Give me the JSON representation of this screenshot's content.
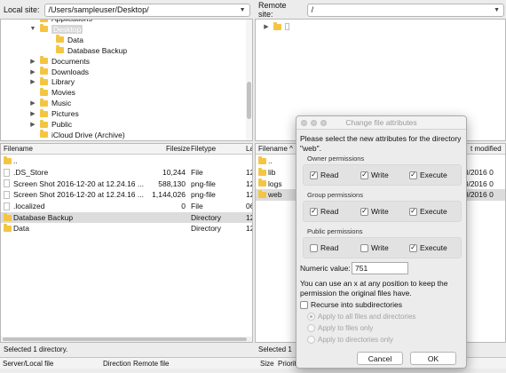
{
  "local": {
    "label": "Local site:",
    "path": "/Users/sampleuser/Desktop/",
    "tree": [
      {
        "label": "Applications",
        "indent": 1,
        "arrow": ""
      },
      {
        "label": "Desktop",
        "indent": 1,
        "arrow": "▼",
        "selected": true
      },
      {
        "label": "Data",
        "indent": 2,
        "arrow": ""
      },
      {
        "label": "Database Backup",
        "indent": 2,
        "arrow": ""
      },
      {
        "label": "Documents",
        "indent": 1,
        "arrow": "▶"
      },
      {
        "label": "Downloads",
        "indent": 1,
        "arrow": "▶"
      },
      {
        "label": "Library",
        "indent": 1,
        "arrow": "▶"
      },
      {
        "label": "Movies",
        "indent": 1,
        "arrow": ""
      },
      {
        "label": "Music",
        "indent": 1,
        "arrow": "▶"
      },
      {
        "label": "Pictures",
        "indent": 1,
        "arrow": "▶"
      },
      {
        "label": "Public",
        "indent": 1,
        "arrow": "▶"
      },
      {
        "label": "iCloud Drive (Archive)",
        "indent": 1,
        "arrow": ""
      }
    ],
    "columns": {
      "name": "Filename",
      "size": "Filesize",
      "type": "Filetype",
      "modified": "La"
    },
    "files": [
      {
        "name": "..",
        "size": "",
        "type": "",
        "mod": "",
        "icon": "folder"
      },
      {
        "name": ".DS_Store",
        "size": "10,244",
        "type": "File",
        "mod": "12",
        "icon": "file"
      },
      {
        "name": "Screen Shot 2016-12-20 at 12.24.16 ...",
        "size": "588,130",
        "type": "png-file",
        "mod": "12",
        "icon": "file"
      },
      {
        "name": "Screen Shot 2016-12-20 at 12.24.16 ...",
        "size": "1,144,026",
        "type": "png-file",
        "mod": "12",
        "icon": "file"
      },
      {
        "name": ".localized",
        "size": "0",
        "type": "File",
        "mod": "06",
        "icon": "file"
      },
      {
        "name": "Database Backup",
        "size": "",
        "type": "Directory",
        "mod": "12",
        "icon": "folder",
        "selected": true
      },
      {
        "name": "Data",
        "size": "",
        "type": "Directory",
        "mod": "12",
        "icon": "folder"
      }
    ],
    "status": "Selected 1 directory."
  },
  "remote": {
    "label": "Remote site:",
    "path": "/",
    "columns": {
      "name": "Filename ^",
      "modified": "t modified"
    },
    "files": [
      {
        "name": "..",
        "mod": "",
        "icon": "folder"
      },
      {
        "name": "lib",
        "mod": "08/2016 0",
        "icon": "folder"
      },
      {
        "name": "logs",
        "mod": "08/2016 0",
        "icon": "folder"
      },
      {
        "name": "web",
        "mod": "08/2016 0",
        "icon": "folder",
        "selected": true
      }
    ],
    "status": "Selected 1"
  },
  "queue": {
    "server": "Server/Local file",
    "direction": "Direction",
    "remote": "Remote file",
    "size": "Size",
    "priority": "Priorit"
  },
  "dialog": {
    "title": "Change file attributes",
    "intro_line1": "Please select the new attributes for the directory",
    "intro_line2": "\"web\".",
    "owner_label": "Owner permissions",
    "group_label": "Group permissions",
    "public_label": "Public permissions",
    "read": "Read",
    "write": "Write",
    "execute": "Execute",
    "owner": {
      "read": true,
      "write": true,
      "execute": true
    },
    "group": {
      "read": true,
      "write": true,
      "execute": true
    },
    "public": {
      "read": false,
      "write": false,
      "execute": true
    },
    "numeric_label": "Numeric value:",
    "numeric_value": "751",
    "hint_line1": "You can use an x at any position to keep the",
    "hint_line2": "permission the original files have.",
    "recurse_label": "Recurse into subdirectories",
    "opt_all": "Apply to all files and directories",
    "opt_files": "Apply to files only",
    "opt_dirs": "Apply to directories only",
    "cancel": "Cancel",
    "ok": "OK",
    "check_mark": "✓"
  }
}
